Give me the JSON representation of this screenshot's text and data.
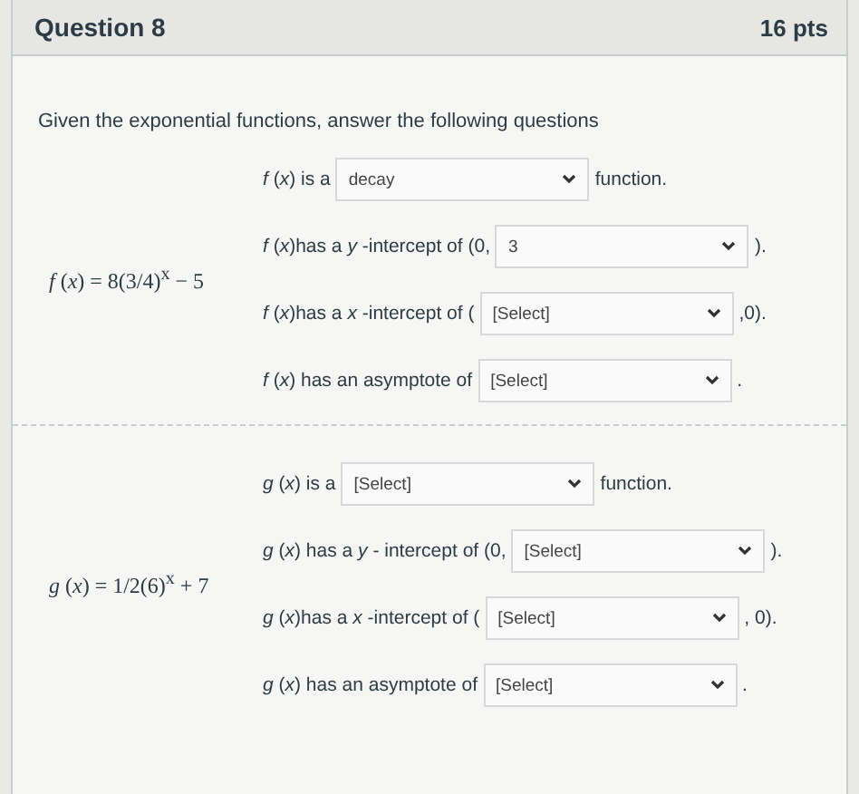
{
  "question": {
    "title": "Question 8",
    "points": "16 pts"
  },
  "intro": "Given the exponential functions, answer the following questions",
  "groups": [
    {
      "formula": "*f* (*x*) = 8(3/4)$^{x}$ − 5",
      "rows": [
        {
          "prefix": "*f* (*x*) is a",
          "value": "decay",
          "suffix": "function."
        },
        {
          "prefix": "*f* (*x*)has a *y* -intercept of (0,",
          "value": "3",
          "suffix": ")."
        },
        {
          "prefix": "*f* (*x*)has a *x* -intercept of (",
          "value": "[Select]",
          "suffix": ",0)."
        },
        {
          "prefix": "*f* (*x*) has an asymptote of",
          "value": "[Select]",
          "suffix": "."
        }
      ]
    },
    {
      "formula": "*g* (*x*) = 1/2(6)$^{x}$ + 7",
      "rows": [
        {
          "prefix": "*g* (*x*) is a",
          "value": "[Select]",
          "suffix": "function."
        },
        {
          "prefix": "*g* (*x*) has a *y* - intercept of (0,",
          "value": "[Select]",
          "suffix": ")."
        },
        {
          "prefix": "*g* (*x*)has a *x* -intercept of (",
          "value": "[Select]",
          "suffix": ", 0)."
        },
        {
          "prefix": "*g* (*x*) has an asymptote of",
          "value": "[Select]",
          "suffix": "."
        }
      ]
    }
  ]
}
